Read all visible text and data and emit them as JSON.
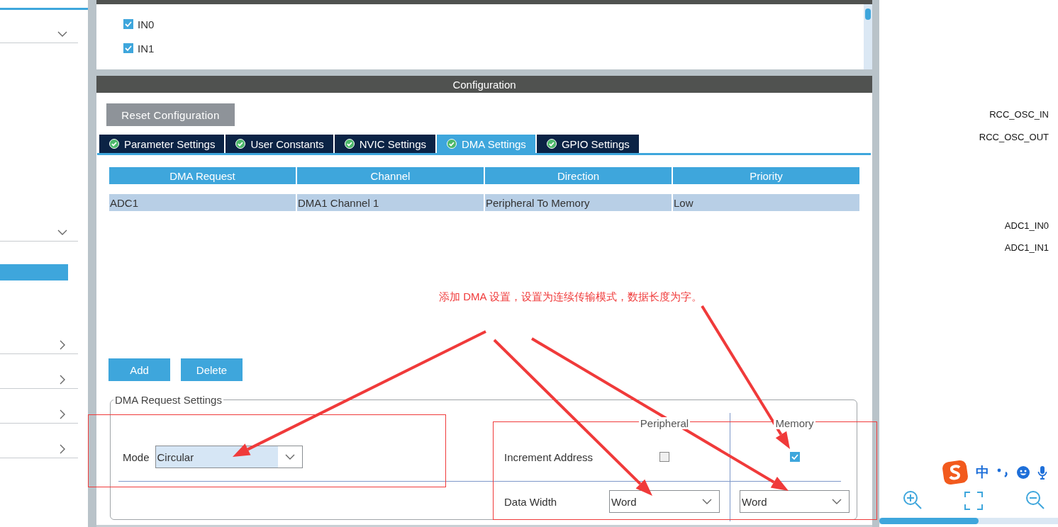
{
  "sidebar": {
    "sections": [
      {
        "expanded": true
      },
      {
        "expanded": true
      },
      {
        "expanded": false
      },
      {
        "expanded": false
      },
      {
        "expanded": false
      },
      {
        "expanded": false
      }
    ]
  },
  "mode_panel": {
    "channels": [
      {
        "label": "IN0",
        "checked": true
      },
      {
        "label": "IN1",
        "checked": true
      }
    ]
  },
  "configuration": {
    "title": "Configuration",
    "reset_button": "Reset Configuration",
    "tabs": [
      {
        "label": "Parameter Settings",
        "selected": false
      },
      {
        "label": "User Constants",
        "selected": false
      },
      {
        "label": "NVIC Settings",
        "selected": false
      },
      {
        "label": "DMA Settings",
        "selected": true
      },
      {
        "label": "GPIO Settings",
        "selected": false
      }
    ],
    "table": {
      "columns": [
        "DMA Request",
        "Channel",
        "Direction",
        "Priority"
      ],
      "rows": [
        {
          "cells": [
            "ADC1",
            "DMA1 Channel 1",
            "Peripheral To Memory",
            "Low"
          ],
          "selected": true
        }
      ]
    },
    "buttons": [
      "Add",
      "Delete"
    ],
    "request_settings": {
      "title": "DMA Request Settings",
      "mode": {
        "label": "Mode",
        "value": "Circular"
      },
      "columns": [
        "Peripheral",
        "Memory"
      ],
      "increment_address": {
        "label": "Increment Address",
        "peripheral": false,
        "memory": true
      },
      "data_width": {
        "label": "Data Width",
        "peripheral": "Word",
        "memory": "Word"
      }
    }
  },
  "annotation": {
    "text": "添加 DMA 设置，设置为连续传输模式，数据长度为字。"
  },
  "pin_labels": [
    "RCC_OSC_IN",
    "RCC_OSC_OUT",
    "ADC1_IN0",
    "ADC1_IN1"
  ],
  "ime_toolbar": {
    "language": "中"
  }
}
